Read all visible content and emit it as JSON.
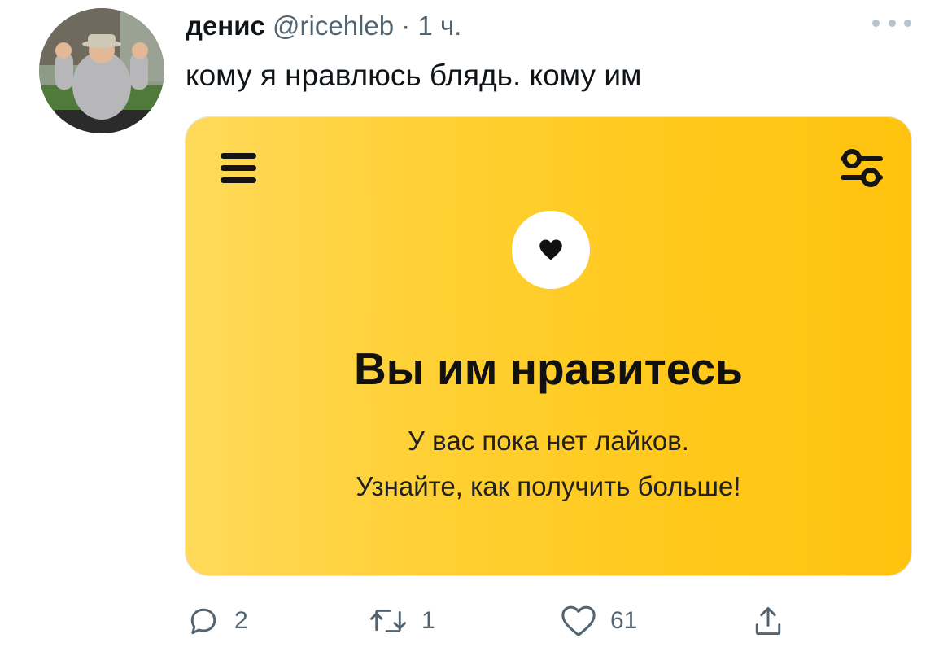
{
  "tweet": {
    "author": {
      "display_name": "денис",
      "handle": "@ricehleb",
      "time_separator": "·",
      "time": "1 ч."
    },
    "text": "кому я нравлюсь блядь. кому им",
    "media": {
      "title": "Вы им нравитесь",
      "subtitle_line1": "У вас пока нет лайков.",
      "subtitle_line2": "Узнайте, как получить больше!",
      "background_color": "#ffd033",
      "icons": [
        "menu-icon",
        "filter-icon",
        "heart-icon"
      ]
    },
    "actions": {
      "reply_count": "2",
      "retweet_count": "1",
      "like_count": "61"
    }
  }
}
